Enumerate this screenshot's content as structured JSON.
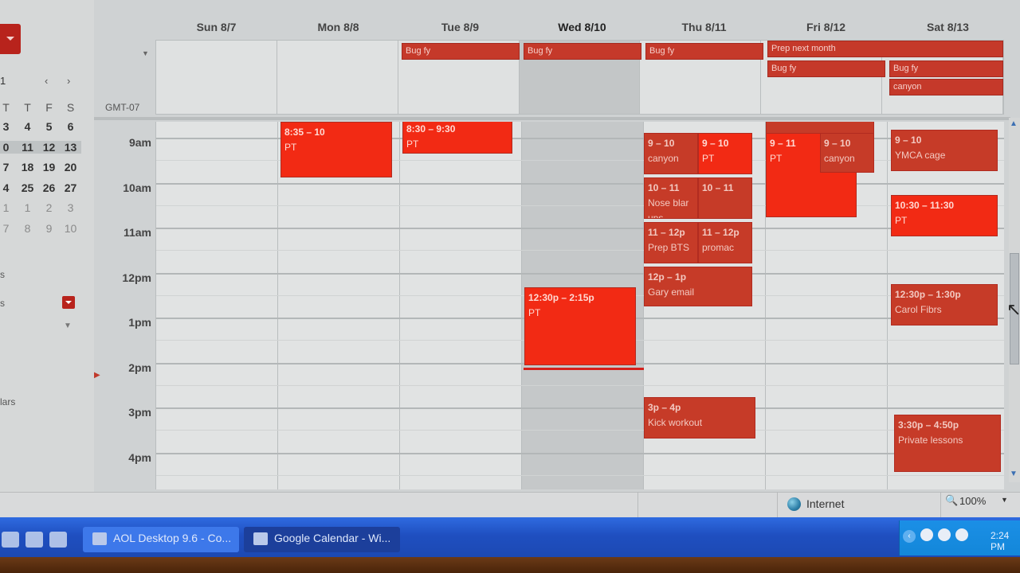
{
  "mini_calendar": {
    "month_fragment": "1",
    "nav": "‹ ›",
    "weekday_heads": [
      "T",
      "T",
      "F",
      "S"
    ],
    "weeks": [
      {
        "days": [
          "3",
          "4",
          "5",
          "6"
        ],
        "style": "normal"
      },
      {
        "days": [
          "0",
          "11",
          "12",
          "13"
        ],
        "style": "sel"
      },
      {
        "days": [
          "7",
          "18",
          "19",
          "20"
        ],
        "style": "normal"
      },
      {
        "days": [
          "4",
          "25",
          "26",
          "27"
        ],
        "style": "normal"
      },
      {
        "days": [
          "1",
          "1",
          "2",
          "3"
        ],
        "style": "dim"
      },
      {
        "days": [
          "7",
          "8",
          "9",
          "10"
        ],
        "style": "dim"
      }
    ],
    "section_fragment_1": "s",
    "section_fragment_2": "s",
    "section_fragment_3": "lars"
  },
  "calendar": {
    "timezone_label": "GMT-07",
    "days": [
      "Sun 8/7",
      "Mon 8/8",
      "Tue 8/9",
      "Wed 8/10",
      "Thu 8/11",
      "Fri 8/12",
      "Sat 8/13"
    ],
    "today_index": 3,
    "hours": [
      "9am",
      "10am",
      "11am",
      "12pm",
      "1pm",
      "2pm",
      "3pm",
      "4pm"
    ],
    "allday_events": [
      {
        "title": "Bug fy",
        "day": 2
      },
      {
        "title": "Bug fy",
        "day": 3
      },
      {
        "title": "Bug fy",
        "day": 4
      },
      {
        "title": "Prep next month",
        "day": 5
      },
      {
        "title": "Bug fy",
        "day": 5
      },
      {
        "title": "Bug fy",
        "day": 6
      },
      {
        "title": "canyon",
        "day": 6
      }
    ],
    "events": [
      {
        "time": "8:35 – 10",
        "title": "PT",
        "day": 1,
        "style": "bright"
      },
      {
        "time": "8:30 – 9:30",
        "title": "PT",
        "day": 2,
        "style": "bright"
      },
      {
        "time": "12:30p – 2:15p",
        "title": "PT",
        "day": 3,
        "style": "bright"
      },
      {
        "time": "9 – 10",
        "title": "canyon",
        "day": 4,
        "style": "dark"
      },
      {
        "time": "9 – 10",
        "title": "PT",
        "day": 4,
        "style": "bright"
      },
      {
        "time": "10 – 11",
        "title": "Nose blar ups",
        "day": 4,
        "style": "dark"
      },
      {
        "time": "10 – 11",
        "title": "",
        "day": 4,
        "style": "dark"
      },
      {
        "time": "11 – 12p",
        "title": "Prep BTS",
        "day": 4,
        "style": "dark"
      },
      {
        "time": "11 – 12p",
        "title": "promac",
        "day": 4,
        "style": "dark"
      },
      {
        "time": "12p – 1p",
        "title": "Gary email",
        "day": 4,
        "style": "dark"
      },
      {
        "time": "3p – 4p",
        "title": "Kick workout",
        "day": 4,
        "style": "dark"
      },
      {
        "time": "",
        "title": "",
        "day": 5,
        "style": "dark"
      },
      {
        "time": "9 – 11",
        "title": "PT",
        "day": 5,
        "style": "bright"
      },
      {
        "time": "9 – 10",
        "title": "canyon",
        "day": 5,
        "style": "dark"
      },
      {
        "time": "9 – 10",
        "title": "YMCA cage",
        "day": 6,
        "style": "dark"
      },
      {
        "time": "10:30 – 11:30",
        "title": "PT",
        "day": 6,
        "style": "bright"
      },
      {
        "time": "12:30p – 1:30p",
        "title": "Carol Fibrs",
        "day": 6,
        "style": "dark"
      },
      {
        "time": "3:30p – 4:50p",
        "title": "Private lessons",
        "day": 6,
        "style": "dark"
      }
    ]
  },
  "statusbar": {
    "zone_label": "Internet",
    "zoom_label": "100%"
  },
  "taskbar": {
    "buttons": [
      {
        "label": "AOL Desktop 9.6 - Co...",
        "active": false
      },
      {
        "label": "Google Calendar - Wi...",
        "active": true
      }
    ],
    "clock": "2:24 PM"
  },
  "colors": {
    "event_bright": "#f22a14",
    "event_dark": "#c63b28",
    "taskbar_blue": "#1f4fc0",
    "accent_red": "#b8231c"
  }
}
